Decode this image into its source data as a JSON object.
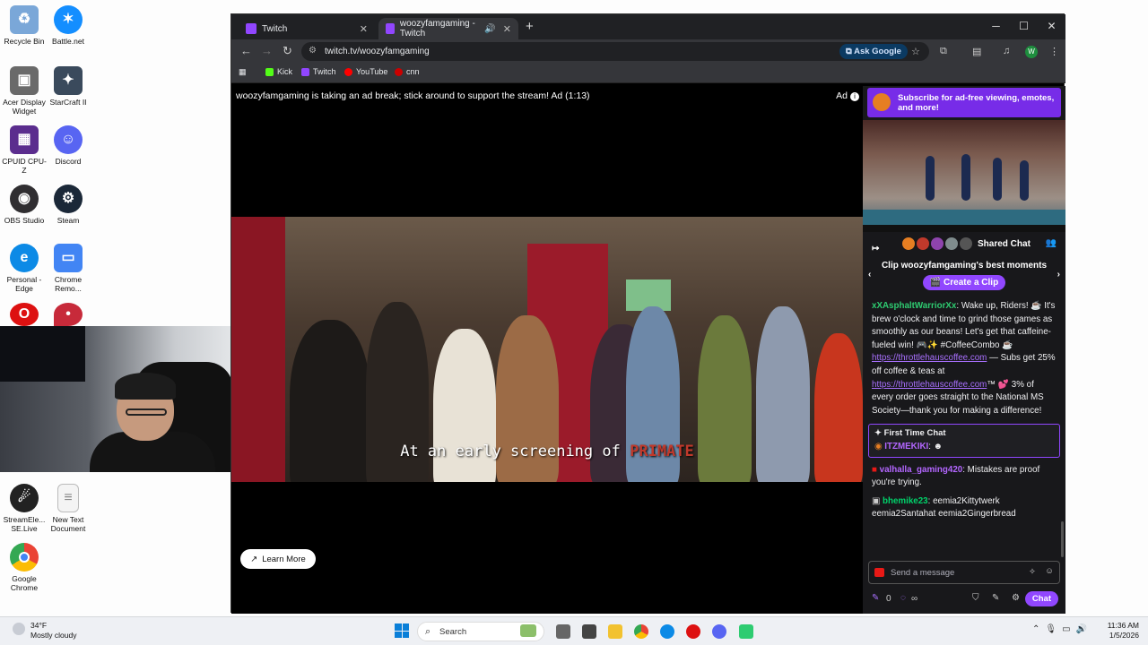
{
  "desktop": {
    "icons": [
      {
        "label": "Recycle Bin",
        "icon": "recycle-bin-icon",
        "color": "#7aa7d8"
      },
      {
        "label": "Battle.net",
        "icon": "battle-net-icon",
        "color": "#148eff"
      },
      {
        "label": "Acer Display Widget",
        "icon": "acer-display-widget-icon",
        "color": "#6a6a6a"
      },
      {
        "label": "StarCraft II",
        "icon": "starcraft-icon",
        "color": "#3a4a5c"
      },
      {
        "label": "CPUID CPU-Z",
        "icon": "cpuz-icon",
        "color": "#5b2d8e"
      },
      {
        "label": "Discord",
        "icon": "discord-icon",
        "color": "#5865f2"
      },
      {
        "label": "OBS Studio",
        "icon": "obs-icon",
        "color": "#302e31"
      },
      {
        "label": "Steam",
        "icon": "steam-icon",
        "color": "#1b2838"
      },
      {
        "label": "Personal - Edge",
        "icon": "edge-icon",
        "color": "#0c8ae6"
      },
      {
        "label": "Chrome Remo...",
        "icon": "chrome-remote-icon",
        "color": "#4285f4"
      },
      {
        "label": "StreamEle... SE.Live",
        "icon": "streamelements-icon",
        "color": "#222"
      },
      {
        "label": "New Text Document",
        "icon": "text-document-icon",
        "color": "#f4f4f4"
      },
      {
        "label": "Google Chrome",
        "icon": "chrome-icon",
        "color": "#4285f4"
      }
    ]
  },
  "browser": {
    "tabs": [
      {
        "title": "Twitch",
        "active": false
      },
      {
        "title": "woozyfamgaming - Twitch",
        "active": true
      }
    ],
    "url": "twitch.tv/woozyfamgaming",
    "ask_google": "Ask Google",
    "profile_initial": "W",
    "bookmarks": [
      {
        "label": "Kick",
        "color": "#53fc18"
      },
      {
        "label": "Twitch",
        "color": "#9146ff"
      },
      {
        "label": "YouTube",
        "color": "#ff0000"
      },
      {
        "label": "cnn",
        "color": "#cc0000"
      }
    ]
  },
  "player": {
    "ad_message": "woozyfamgaming is taking an ad break; stick around to support the stream! Ad (1:13)",
    "ad_label": "Ad",
    "subtitle_prefix": "At an early screening of",
    "subtitle_highlight": "PRIMATE",
    "learn_more": "Learn More"
  },
  "chat": {
    "sub_banner": "Subscribe for ad-free viewing, emotes, and more!",
    "shared_chat": "Shared Chat",
    "clip_prompt": "Clip woozyfamgaming's best moments",
    "create_clip": "Create a Clip",
    "messages": {
      "m1_user": "xXAsphaltWarriorXx",
      "m1_text": ": Wake up, Riders! ☕ It's brew o'clock and time to grind those games as smoothly as our beans! Let's get that caffeine-fueled win! 🎮✨ #CoffeeCombo ☕",
      "m1_link1": "https://throttlehauscoffee.com",
      "m1_mid": " — Subs get 25% off coffee & teas at ",
      "m1_link2": "https://throttlehauscoffee.com",
      "m1_end": "™ 💕 3% of every order goes straight to the National MS Society—thank you for making a difference!",
      "first_time_header": "First Time Chat",
      "first_time_user": "ITZMEKIKI",
      "m2_user": "valhalla_gaming420",
      "m2_text": ": Mistakes are proof you're trying.",
      "m3_user": "bhemike23",
      "m3_text": ": eemia2Kittytwerk eemia2Santahat eemia2Gingerbread"
    },
    "input_placeholder": "Send a message",
    "points": "0",
    "infinity": "∞",
    "chat_button": "Chat",
    "colors": {
      "accent": "#9147ff",
      "user1": "#2ecc71",
      "user2": "#b366ff",
      "user3": "#00d26a",
      "first_user": "#b366ff"
    }
  },
  "taskbar": {
    "temperature": "34°F",
    "weather": "Mostly cloudy",
    "search_placeholder": "Search",
    "time": "11:36 AM",
    "date": "1/5/2026"
  }
}
